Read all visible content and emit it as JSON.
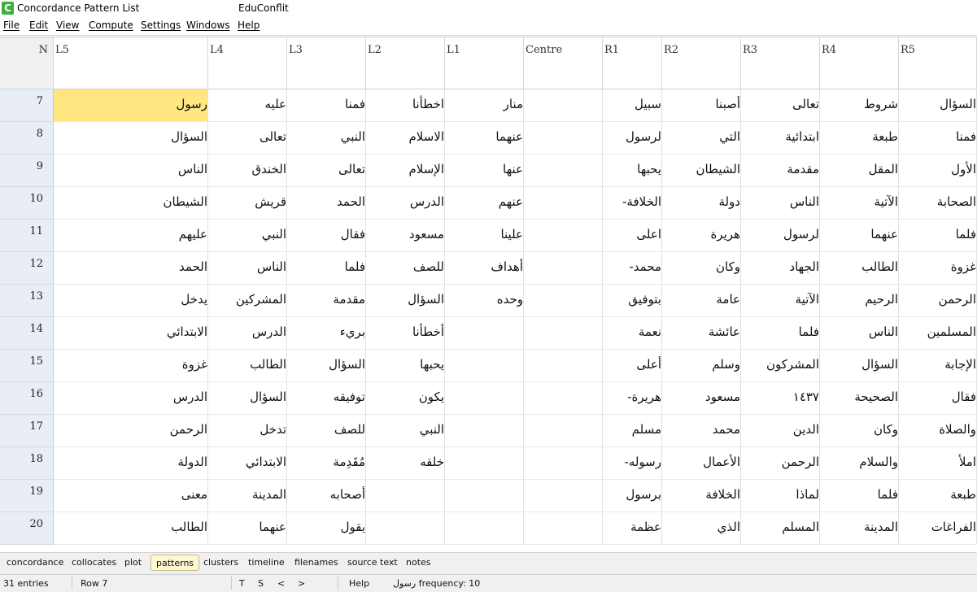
{
  "window": {
    "title": "Concordance Pattern List",
    "project": "EduConflit",
    "icon": "corpus-app-icon",
    "icon_letter": "C"
  },
  "menu": [
    "File",
    "Edit",
    "View",
    "Compute",
    "Settings",
    "Windows",
    "Help"
  ],
  "columns": [
    "N",
    "L5",
    "L4",
    "L3",
    "L2",
    "L1",
    "Centre",
    "R1",
    "R2",
    "R3",
    "R4",
    "R5"
  ],
  "rows": [
    {
      "n": "7",
      "L5": "رسول",
      "L4": "عليه",
      "L3": "فمنا",
      "L2": "اخطأنا",
      "L1": "منار",
      "Centre": "",
      "R1": "سبيل",
      "R2": "أصبنا",
      "R3": "تعالى",
      "R4": "شروط",
      "R5": "السؤال"
    },
    {
      "n": "8",
      "L5": "السؤال",
      "L4": "تعالى",
      "L3": "النبي",
      "L2": "الاسلام",
      "L1": "عنهما",
      "Centre": "",
      "R1": "لرسول",
      "R2": "التي",
      "R3": "ابتدائية",
      "R4": "طبعة",
      "R5": "فمنا"
    },
    {
      "n": "9",
      "L5": "الناس",
      "L4": "الخندق",
      "L3": "تعالى",
      "L2": "الإسلام",
      "L1": "عنها",
      "Centre": "",
      "R1": "يحبها",
      "R2": "الشيطان",
      "R3": "مقدمة",
      "R4": "المقل",
      "R5": "الأول"
    },
    {
      "n": "10",
      "L5": "الشيطان",
      "L4": "قريش",
      "L3": "الحمد",
      "L2": "الدرس",
      "L1": "عنهم",
      "Centre": "",
      "R1": "الخلافة-",
      "R2": "دولة",
      "R3": "الناس",
      "R4": "الآتية",
      "R5": "الصحابة"
    },
    {
      "n": "11",
      "L5": "عليهم",
      "L4": "النبي",
      "L3": "فقال",
      "L2": "مسعود",
      "L1": "علينا",
      "Centre": "",
      "R1": "اعلى",
      "R2": "هريرة",
      "R3": "لرسول",
      "R4": "عنهما",
      "R5": "فلما"
    },
    {
      "n": "12",
      "L5": "الحمد",
      "L4": "الناس",
      "L3": "فلما",
      "L2": "للصف",
      "L1": "أهداف",
      "Centre": "",
      "R1": "محمد-",
      "R2": "وكان",
      "R3": "الجهاد",
      "R4": "الطالب",
      "R5": "غزوة"
    },
    {
      "n": "13",
      "L5": "يدخل",
      "L4": "المشركين",
      "L3": "مقدمة",
      "L2": "السؤال",
      "L1": "وحده",
      "Centre": "",
      "R1": "بتوفيق",
      "R2": "عامة",
      "R3": "الآتية",
      "R4": "الرحيم",
      "R5": "الرحمن"
    },
    {
      "n": "14",
      "L5": "الابتدائي",
      "L4": "الدرس",
      "L3": "بريء",
      "L2": "أخطأنا",
      "L1": "",
      "Centre": "",
      "R1": "نعمة",
      "R2": "عائشة",
      "R3": "فلما",
      "R4": "الناس",
      "R5": "المسلمين"
    },
    {
      "n": "15",
      "L5": "غزوة",
      "L4": "الطالب",
      "L3": "السؤال",
      "L2": "يحبها",
      "L1": "",
      "Centre": "",
      "R1": "أعلى",
      "R2": "وسلم",
      "R3": "المشركون",
      "R4": "السؤال",
      "R5": "الإجابة"
    },
    {
      "n": "16",
      "L5": "الدرس",
      "L4": "السؤال",
      "L3": "توفيقه",
      "L2": "يكون",
      "L1": "",
      "Centre": "",
      "R1": "هريرة-",
      "R2": "مسعود",
      "R3": "١٤٣٧",
      "R4": "الصحيحة",
      "R5": "فقال"
    },
    {
      "n": "17",
      "L5": "الرحمن",
      "L4": "تدخل",
      "L3": "للصف",
      "L2": "النبي",
      "L1": "",
      "Centre": "",
      "R1": "مسلم",
      "R2": "محمد",
      "R3": "الدين",
      "R4": "وكان",
      "R5": "والصلاة"
    },
    {
      "n": "18",
      "L5": "الدولة",
      "L4": "الابتدائي",
      "L3": "مُقَدِمة",
      "L2": "خلقه",
      "L1": "",
      "Centre": "",
      "R1": "رسوله-",
      "R2": "الأعمال",
      "R3": "الرحمن",
      "R4": "والسلام",
      "R5": "املأ"
    },
    {
      "n": "19",
      "L5": "معنى",
      "L4": "المدينة",
      "L3": "أصحابه",
      "L2": "",
      "L1": "",
      "Centre": "",
      "R1": "برسول",
      "R2": "الخلافة",
      "R3": "لماذا",
      "R4": "فلما",
      "R5": "طبعة"
    },
    {
      "n": "20",
      "L5": "الطالب",
      "L4": "عنهما",
      "L3": "يقول",
      "L2": "",
      "L1": "",
      "Centre": "",
      "R1": "عظمة",
      "R2": "الذي",
      "R3": "المسلم",
      "R4": "المدينة",
      "R5": "الفراغات"
    }
  ],
  "selected_cell": {
    "row": "7",
    "column": "L5"
  },
  "tabs": [
    "concordance",
    "collocates",
    "plot",
    "patterns",
    "clusters",
    "timeline",
    "filenames",
    "source text",
    "notes"
  ],
  "active_tab": "patterns",
  "status": {
    "entries": "31 entries",
    "row": "Row 7",
    "btn_t": "T",
    "btn_s": "S",
    "btn_prev": "<",
    "btn_next": ">",
    "help": "Help",
    "frequency": "رسول frequency: 10"
  },
  "colors": {
    "selected_cell": "#ffe680",
    "row_header": "#e9eef6",
    "active_tab": "#fff7d1",
    "app_icon": "#3fae3a"
  }
}
